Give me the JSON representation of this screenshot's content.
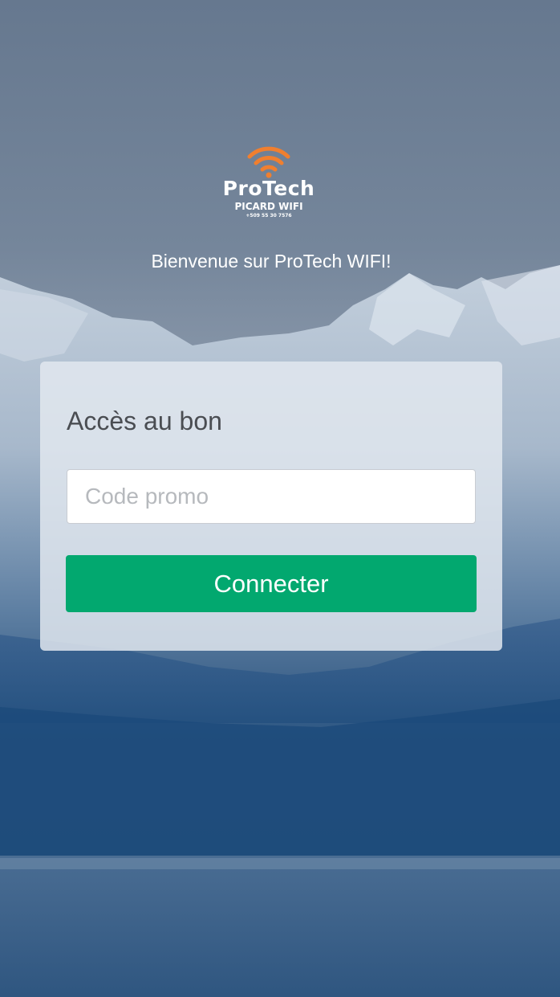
{
  "logo": {
    "name": "ProTech",
    "subtitle": "PICARD WIFI",
    "phone": "+509 55 30 7576",
    "accent_color": "#f07f2f",
    "icon": "wifi-icon"
  },
  "welcome_text": "Bienvenue sur ProTech WIFI!",
  "card": {
    "title": "Accès au bon",
    "input_placeholder": "Code promo",
    "input_value": "",
    "button_label": "Connecter",
    "button_color": "#02a86f"
  }
}
